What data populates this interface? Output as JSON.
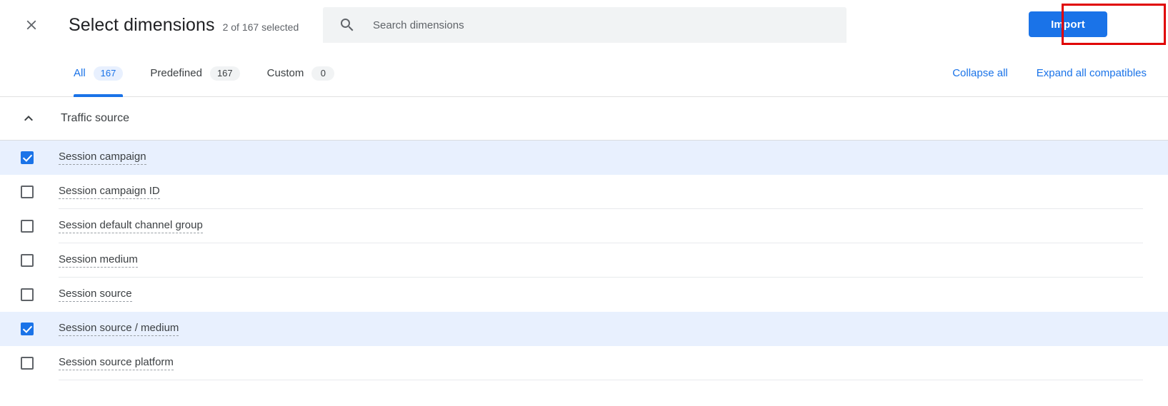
{
  "header": {
    "close_icon": "close-icon",
    "title": "Select dimensions",
    "subtitle": "2 of 167 selected",
    "search": {
      "icon": "search-icon",
      "placeholder": "Search dimensions",
      "value": ""
    },
    "import_label": "Import"
  },
  "tabs": [
    {
      "label": "All",
      "badge": "167",
      "active": true
    },
    {
      "label": "Predefined",
      "badge": "167",
      "active": false
    },
    {
      "label": "Custom",
      "badge": "0",
      "active": false
    }
  ],
  "tab_actions": [
    {
      "label": "Collapse all"
    },
    {
      "label": "Expand all compatibles"
    }
  ],
  "group": {
    "chevron_icon": "chevron-up-icon",
    "title": "Traffic source",
    "expanded": true
  },
  "rows": [
    {
      "label": "Session campaign",
      "checked": true
    },
    {
      "label": "Session campaign ID",
      "checked": false
    },
    {
      "label": "Session default channel group",
      "checked": false
    },
    {
      "label": "Session medium",
      "checked": false
    },
    {
      "label": "Session source",
      "checked": false
    },
    {
      "label": "Session source / medium",
      "checked": true
    },
    {
      "label": "Session source platform",
      "checked": false
    }
  ],
  "colors": {
    "accent": "#1a73e8",
    "selected_row": "#e8f0fe",
    "annotation": "#e00000",
    "search_bg": "#f1f3f4",
    "text_primary": "#202124",
    "text_secondary": "#5f6368"
  }
}
